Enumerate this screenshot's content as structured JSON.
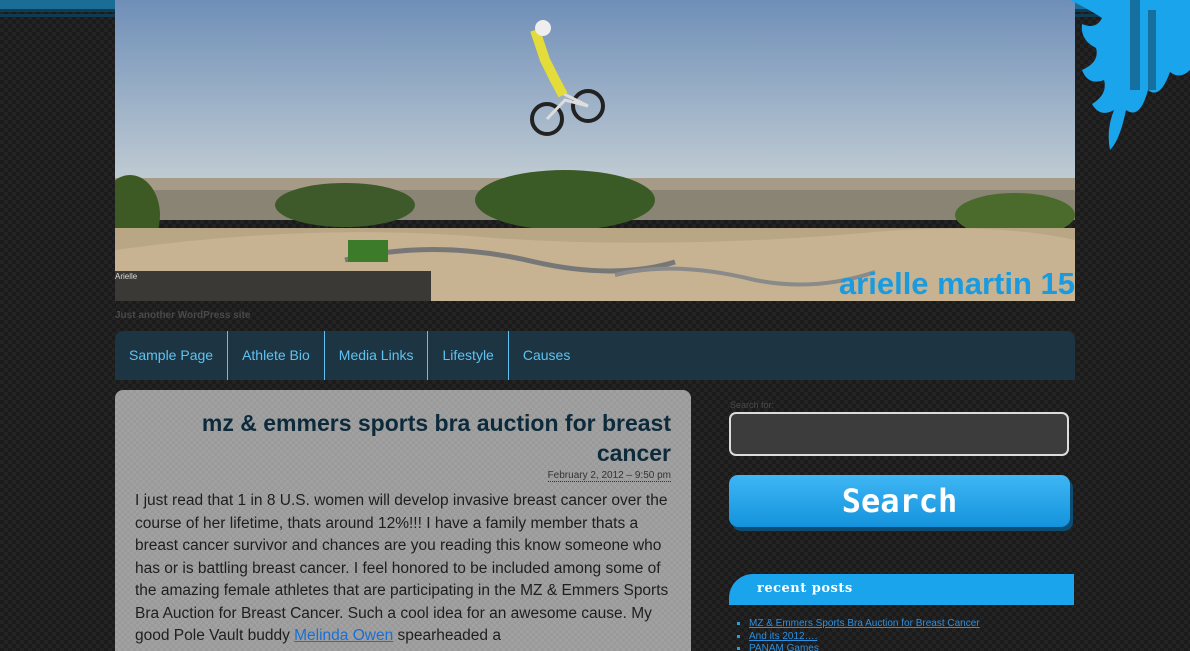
{
  "header": {
    "image_caption": "Arielle",
    "site_title": "arielle martin 15",
    "tagline": "Just another WordPress site"
  },
  "nav": {
    "items": [
      "Sample Page",
      "Athlete Bio",
      "Media Links",
      "Lifestyle",
      "Causes"
    ]
  },
  "post": {
    "title": "mz & emmers sports bra auction for breast cancer",
    "date": "February 2, 2012 – 9:50 pm",
    "body_before_link": "I just read that 1 in 8 U.S. women will develop invasive breast cancer over the course of her lifetime, thats around 12%!!! I have a family member thats a breast cancer survivor and chances are you reading this know someone who has or is battling breast cancer.  I feel honored to be included among some of the amazing female athletes that are participating in the MZ & Emmers Sports Bra Auction for Breast Cancer. Such a cool idea for an awesome cause. My good Pole Vault buddy ",
    "link_text": "Melinda Owen",
    "body_after_link": " spearheaded a"
  },
  "sidebar": {
    "search_label": "Search for:",
    "search_value": "",
    "search_button": "Search",
    "recent_title": "recent posts",
    "recent_posts": [
      "MZ & Emmers Sports Bra Auction for Breast Cancer",
      "And its 2012….",
      "PANAM Games"
    ]
  },
  "colors": {
    "accent": "#1aa4ec",
    "title": "#1a9be0",
    "nav_bg": "#1d3542"
  }
}
